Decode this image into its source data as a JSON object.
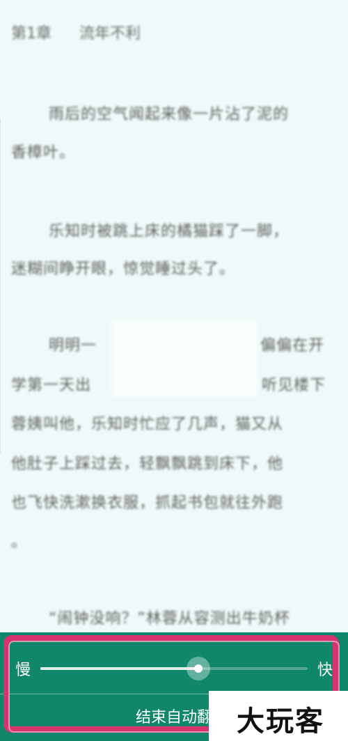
{
  "book": {
    "chapter_number": "第1章",
    "chapter_name": "流年不利",
    "lines": [
      "雨后的空气闻起来像一片沾了泥的",
      "香樟叶。",
      "乐知时被跳上床的橘猫踩了一脚，",
      "迷糊间睁开眼，惊觉睡过头了。",
      "明明一",
      "偏偏在开",
      "学第一天出",
      "听见楼下",
      "蓉姨叫他，乐知时忙应了几声，猫又从",
      "他肚子上踩过去，轻飘飘跳到床下，他",
      "也飞快洗漱换衣服，抓起书包就往外跑",
      "。",
      "“闹钟没响？”林蓉从容测出牛奶杯"
    ]
  },
  "auto_page": {
    "slow_label": "慢",
    "fast_label": "快",
    "speed_fraction": 0.59,
    "stop_label": "结束自动翻"
  },
  "watermark": {
    "text": "大玩客"
  },
  "colors": {
    "panel_green": "#10876a",
    "highlight_pink": "#d6336f",
    "page_background": "#eefaf9"
  }
}
